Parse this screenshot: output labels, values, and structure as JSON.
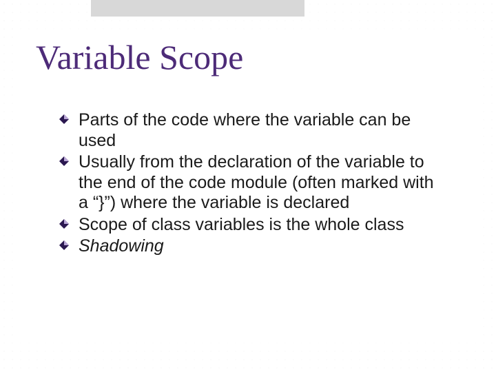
{
  "slide": {
    "title": "Variable Scope",
    "bullets": [
      {
        "text": "Parts of the code where the variable can be used",
        "italic": false
      },
      {
        "text": "Usually from the declaration of the variable to the end of the code module (often marked with a “}”) where the variable is declared",
        "italic": false
      },
      {
        "text": "Scope of class variables is the whole class",
        "italic": false
      },
      {
        "text": "Shadowing",
        "italic": true
      }
    ]
  },
  "colors": {
    "title": "#4d2b78",
    "bullet_dark": "#2b1850",
    "bullet_light": "#b9a6d6"
  }
}
